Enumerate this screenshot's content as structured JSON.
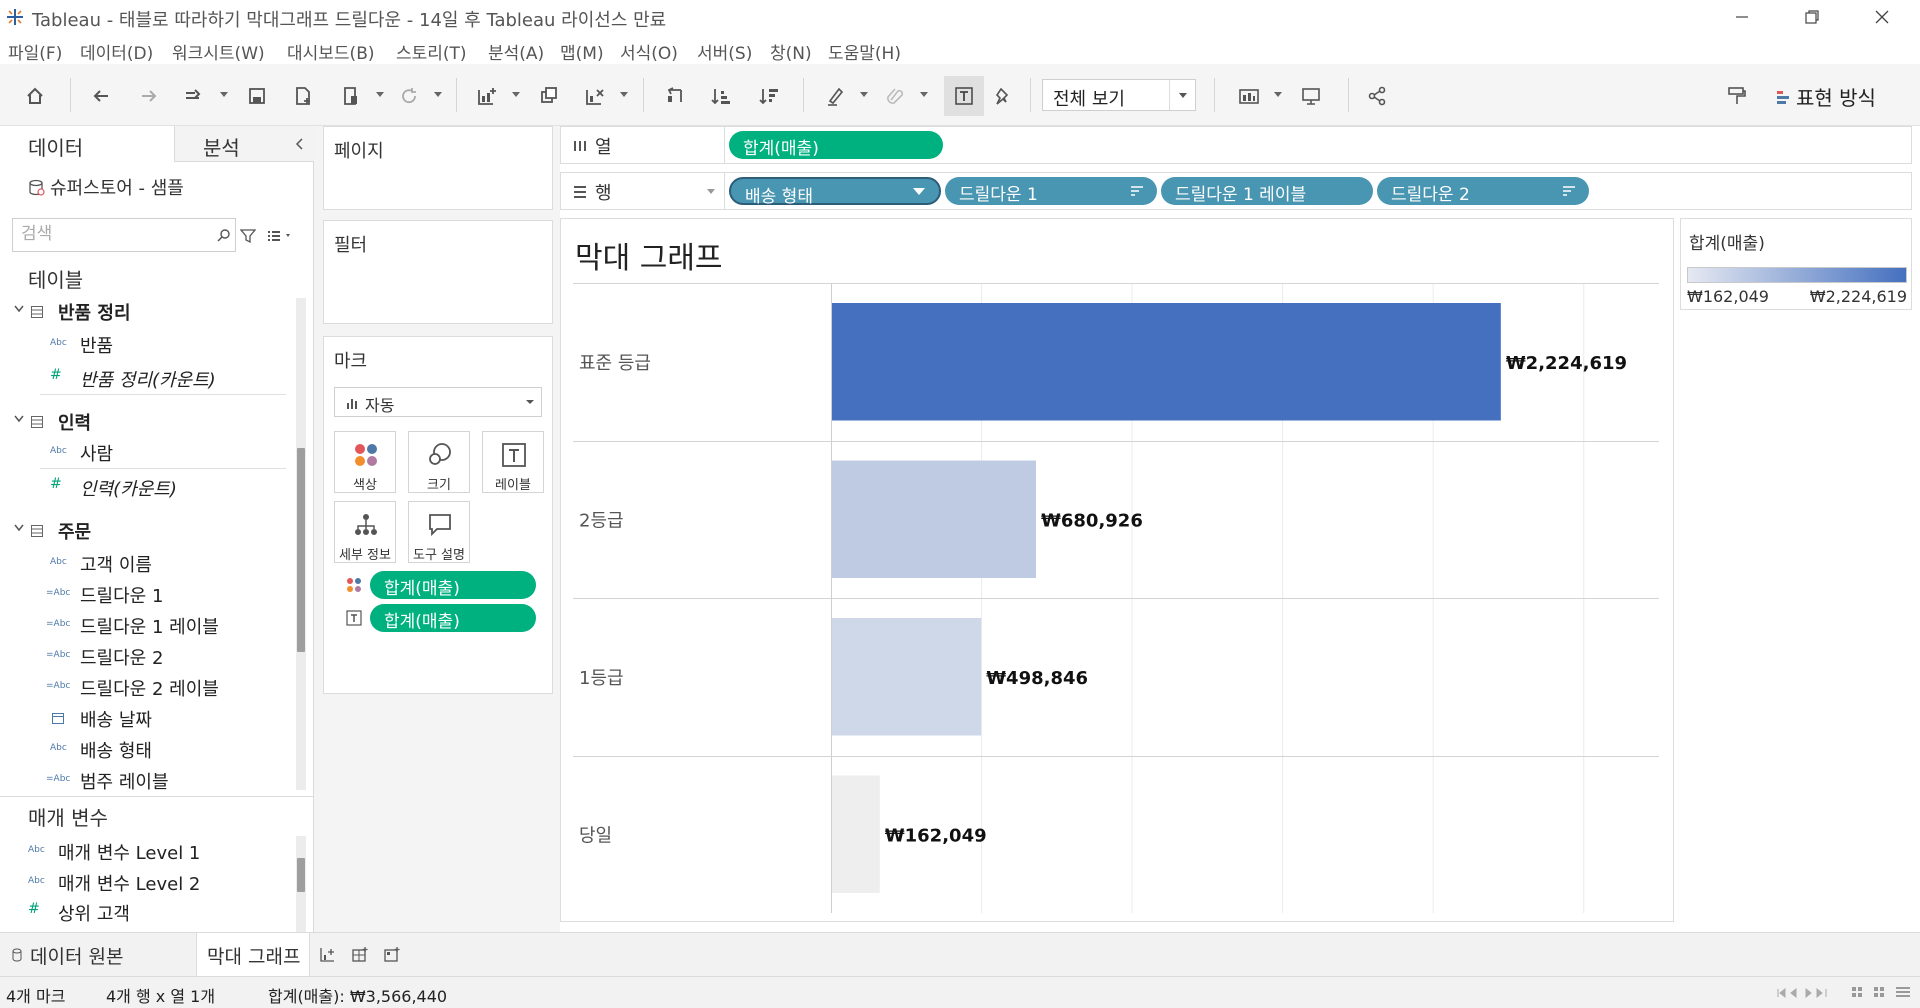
{
  "window": {
    "title": "Tableau - 태블로 따라하기 막대그래프 드릴다운 - 14일 후 Tableau 라이선스 만료"
  },
  "menu": [
    "파일(F)",
    "데이터(D)",
    "워크시트(W)",
    "대시보드(B)",
    "스토리(T)",
    "분석(A)",
    "맵(M)",
    "서식(O)",
    "서버(S)",
    "창(N)",
    "도움말(H)"
  ],
  "toolbar": {
    "view_select": "전체 보기",
    "show_me": "표현 방식"
  },
  "left_pane": {
    "tab_data": "데이터",
    "tab_analysis": "분석",
    "datasource": "슈퍼스토어 - 샘플",
    "search_placeholder": "검색",
    "tables_title": "테이블",
    "groups": [
      {
        "name": "반품 정리",
        "fields": [
          {
            "type": "Abc",
            "name": "반품"
          },
          {
            "type": "#",
            "name": "반품 정리(카운트)"
          }
        ]
      },
      {
        "name": "인력",
        "fields": [
          {
            "type": "Abc",
            "name": "사람"
          },
          {
            "type": "#",
            "name": "인력(카운트)"
          }
        ]
      },
      {
        "name": "주문",
        "fields": [
          {
            "type": "Abc",
            "name": "고객 이름"
          },
          {
            "type": "=Abc",
            "name": "드릴다운 1"
          },
          {
            "type": "=Abc",
            "name": "드릴다운 1 레이블"
          },
          {
            "type": "=Abc",
            "name": "드릴다운 2"
          },
          {
            "type": "=Abc",
            "name": "드릴다운 2 레이블"
          },
          {
            "type": "date",
            "name": "배송 날짜"
          },
          {
            "type": "Abc",
            "name": "배송 형태"
          },
          {
            "type": "=Abc",
            "name": "범주 레이블"
          }
        ]
      }
    ],
    "params_title": "매개 변수",
    "params": [
      {
        "type": "Abc",
        "name": "매개 변수 Level 1"
      },
      {
        "type": "Abc",
        "name": "매개 변수 Level 2"
      },
      {
        "type": "#",
        "name": "상위 고객"
      }
    ]
  },
  "cards": {
    "pages": "페이지",
    "filters": "필터",
    "marks": "마크",
    "mark_type": "자동",
    "buttons": [
      "색상",
      "크기",
      "레이블",
      "세부 정보",
      "도구 설명"
    ],
    "mark_pills": [
      "합계(매출)",
      "합계(매출)"
    ]
  },
  "shelves": {
    "columns_label": "열",
    "rows_label": "행",
    "columns": [
      "합계(매출)"
    ],
    "rows": [
      "배송 형태",
      "드릴다운 1",
      "드릴다운 1 레이블",
      "드릴다운 2"
    ]
  },
  "view": {
    "sheet_title": "막대 그래프"
  },
  "legend": {
    "title": "합계(매출)",
    "min": "₩162,049",
    "max": "₩2,224,619",
    "color_min": "#e6e9f2",
    "color_max": "#4470bf"
  },
  "chart_data": {
    "type": "bar",
    "orientation": "horizontal",
    "categories": [
      "표준 등급",
      "2등급",
      "1등급",
      "당일"
    ],
    "values": [
      2224619,
      680926,
      498846,
      162049
    ],
    "value_labels": [
      "₩2,224,619",
      "₩680,926",
      "₩498,846",
      "₩162,049"
    ],
    "colors": [
      "#4470bf",
      "#bfcbe3",
      "#cfd8e9",
      "#eeeeee"
    ],
    "xlim": [
      0,
      2750000
    ],
    "grid": true
  },
  "sheet_tabs": {
    "datasource_tab": "데이터 원본",
    "active_sheet": "막대 그래프"
  },
  "status": {
    "marks": "4개 마크",
    "rows_cols": "4개 행  x  열 1개",
    "sum": "합계(매출): ₩3,566,440"
  }
}
